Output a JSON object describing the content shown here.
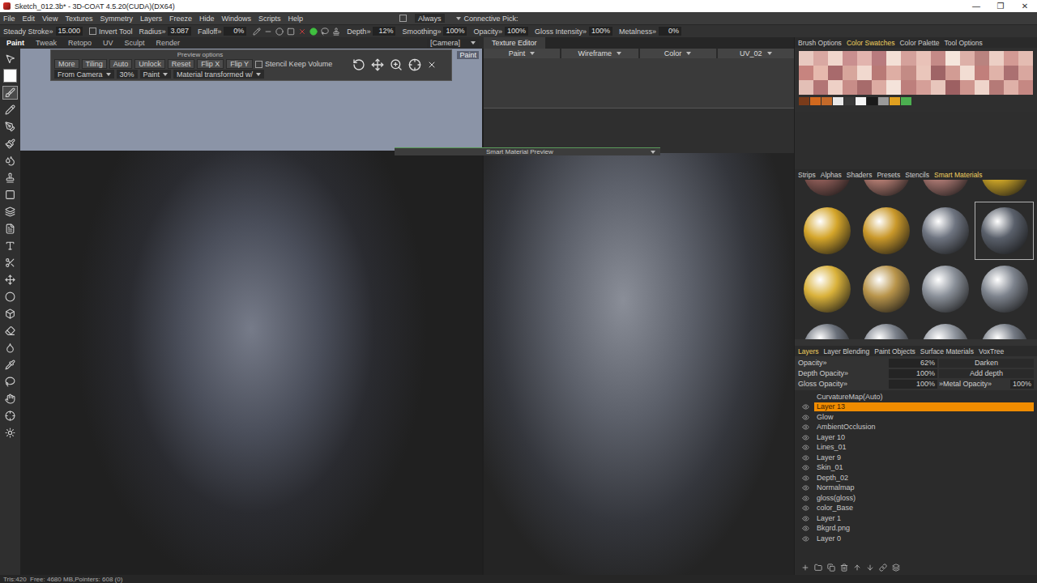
{
  "window": {
    "title": "Sketch_012.3b* - 3D-COAT 4.5.20(CUDA)(DX64)",
    "controls": [
      "—",
      "❐",
      "✕"
    ]
  },
  "menu": [
    "File",
    "Edit",
    "View",
    "Textures",
    "Symmetry",
    "Layers",
    "Freeze",
    "Hide",
    "Windows",
    "Scripts",
    "Help"
  ],
  "menu_extras": {
    "lock_box": {
      "checked": false
    },
    "always": "Always",
    "connective_pick": "Connective Pick:"
  },
  "tool_params": [
    {
      "kind": "field",
      "label": "Steady Stroke»",
      "value": "15.000"
    },
    {
      "kind": "check",
      "label": "Invert Tool",
      "checked": false
    },
    {
      "kind": "field",
      "label": "Radius»",
      "value": "3.087"
    },
    {
      "kind": "field",
      "label": "Falloff»",
      "value": "0%"
    },
    {
      "kind": "icons"
    },
    {
      "kind": "field",
      "label": "Depth»",
      "value": "12%"
    },
    {
      "kind": "field",
      "label": "Smoothing»",
      "value": "100%"
    },
    {
      "kind": "field",
      "label": "Opacity»",
      "value": "100%"
    },
    {
      "kind": "field",
      "label": "Gloss Intensity»",
      "value": "100%"
    },
    {
      "kind": "field",
      "label": "Metalness»",
      "value": "0%"
    }
  ],
  "rooms": [
    {
      "label": "Paint",
      "selected": true
    },
    {
      "label": "Tweak",
      "selected": false
    },
    {
      "label": "Retopo",
      "selected": false
    },
    {
      "label": "UV",
      "selected": false
    },
    {
      "label": "Sculpt",
      "selected": false
    },
    {
      "label": "Render",
      "selected": false
    }
  ],
  "view_mode": "[Camera]",
  "viewport_label": "Paint",
  "current_color": "#ffffff",
  "tools": [
    {
      "selected": false
    },
    {
      "selected": true
    },
    {
      "selected": false
    },
    {
      "selected": false
    },
    {
      "selected": false
    },
    {
      "selected": false
    },
    {
      "selected": false
    },
    {
      "selected": false
    },
    {
      "selected": false
    },
    {
      "selected": false
    },
    {
      "selected": false
    },
    {
      "selected": false
    },
    {
      "selected": false
    },
    {
      "selected": false
    },
    {
      "selected": false
    },
    {
      "selected": false
    },
    {
      "selected": false
    },
    {
      "selected": false
    },
    {
      "selected": false
    },
    {
      "selected": false
    },
    {
      "selected": false
    },
    {
      "selected": false
    }
  ],
  "preview_options": {
    "title": "Preview options",
    "buttons": [
      "More",
      "Tiling",
      "Auto",
      "Unlock",
      "Reset",
      "Flip X",
      "Flip Y"
    ],
    "keep_volume": {
      "label": "Stencil Keep Volume",
      "checked": false
    },
    "projection": "From Camera",
    "scale": "30%",
    "mode": "Paint",
    "transform": "Material transformed w/"
  },
  "texture_editor": {
    "title": "Texture Editor",
    "fields": [
      "Paint",
      "Wireframe",
      "Color",
      "UV_02"
    ]
  },
  "smart_material_preview": "Smart Material Preview",
  "brush_tabs": [
    {
      "label": "Brush Options",
      "selected": false
    },
    {
      "label": "Color Swatches",
      "selected": true
    },
    {
      "label": "Color Palette",
      "selected": false
    },
    {
      "label": "Tool Options",
      "selected": false
    }
  ],
  "swatches": [
    {
      "color": "#e8c9c0"
    },
    {
      "color": "#d9a8a2"
    },
    {
      "color": "#f0d6cc"
    },
    {
      "color": "#c98f8f"
    },
    {
      "color": "#e2b4ae"
    },
    {
      "color": "#b87b7e"
    },
    {
      "color": "#f3e0d6"
    },
    {
      "color": "#d4a19b"
    },
    {
      "color": "#e9c2b8"
    },
    {
      "color": "#c48a87"
    },
    {
      "color": "#f5e6dc"
    },
    {
      "color": "#ddb0a8"
    },
    {
      "color": "#b9837f"
    },
    {
      "color": "#eccfc5"
    },
    {
      "color": "#d39a94"
    },
    {
      "color": "#e4bcb2"
    },
    {
      "color": "#c7847f"
    },
    {
      "color": "#e6b9ad"
    },
    {
      "color": "#a86a6c"
    },
    {
      "color": "#d7a69c"
    },
    {
      "color": "#f1d9cf"
    },
    {
      "color": "#b97a76"
    },
    {
      "color": "#deaea4"
    },
    {
      "color": "#c38b85"
    },
    {
      "color": "#eac6bb"
    },
    {
      "color": "#9f6466"
    },
    {
      "color": "#d29c94"
    },
    {
      "color": "#f2ddd3"
    },
    {
      "color": "#c17f7b"
    },
    {
      "color": "#e0b3a9"
    },
    {
      "color": "#ab7071"
    },
    {
      "color": "#d9a79f"
    },
    {
      "color": "#e3bfb6"
    },
    {
      "color": "#b27575"
    },
    {
      "color": "#eed0c6"
    },
    {
      "color": "#c88d88"
    },
    {
      "color": "#a76b6b"
    },
    {
      "color": "#dcaba2"
    },
    {
      "color": "#f4e3da"
    },
    {
      "color": "#bd7f7c"
    },
    {
      "color": "#d59f98"
    },
    {
      "color": "#e8c6bc"
    },
    {
      "color": "#9d6062"
    },
    {
      "color": "#cf968f"
    },
    {
      "color": "#efd5cb"
    },
    {
      "color": "#b57a77"
    },
    {
      "color": "#dfb1a8"
    },
    {
      "color": "#c58883"
    }
  ],
  "swatch_strip": [
    {
      "color": "#7a3b1a"
    },
    {
      "color": "#d2691e"
    },
    {
      "color": "#c46a2a"
    },
    {
      "color": "#e8e8e8"
    },
    {
      "color": "#3a3a3a"
    },
    {
      "color": "#f5f5f5"
    },
    {
      "color": "#1a1a1a"
    },
    {
      "color": "#9a9a9a"
    },
    {
      "color": "#e0a020"
    },
    {
      "color": "#4caf50"
    }
  ],
  "library_tabs": [
    {
      "label": "Strips",
      "selected": false
    },
    {
      "label": "Alphas",
      "selected": false
    },
    {
      "label": "Shaders",
      "selected": false
    },
    {
      "label": "Presets",
      "selected": false
    },
    {
      "label": "Stencils",
      "selected": false
    },
    {
      "label": "Smart Materials",
      "selected": true
    }
  ],
  "materials": [
    {
      "color": "#8a5a55",
      "selected": false
    },
    {
      "color": "#b07a70",
      "selected": false
    },
    {
      "color": "#a87670",
      "selected": false
    },
    {
      "color": "#c9a227",
      "selected": false
    },
    {
      "color": "#d4a52a",
      "selected": false
    },
    {
      "color": "#c9982a",
      "selected": false
    },
    {
      "color": "#6e7480",
      "selected": false
    },
    {
      "color": "#5a606b",
      "selected": true
    },
    {
      "color": "#d9b13a",
      "selected": false
    },
    {
      "color": "#b8944a",
      "selected": false
    },
    {
      "color": "#8a9099",
      "selected": false
    },
    {
      "color": "#7d838d",
      "selected": false
    },
    {
      "color": "#6a707a",
      "selected": false
    },
    {
      "color": "#7a808a",
      "selected": false
    },
    {
      "color": "#8e949d",
      "selected": false
    },
    {
      "color": "#737983",
      "selected": false
    }
  ],
  "layer_tabs": [
    {
      "label": "Layers",
      "selected": true
    },
    {
      "label": "Layer Blending",
      "selected": false
    },
    {
      "label": "Paint Objects",
      "selected": false
    },
    {
      "label": "Surface Materials",
      "selected": false
    },
    {
      "label": "VoxTree",
      "selected": false
    }
  ],
  "layer_props": [
    {
      "label": "Opacity»",
      "value": "62%",
      "mode": "Darken"
    },
    {
      "label": "Depth Opacity»",
      "value": "100%",
      "mode": "Add depth"
    },
    {
      "label": "Gloss Opacity»",
      "value": "100%",
      "extra_label": "»Metal Opacity»",
      "extra_value": "100%"
    }
  ],
  "layers": [
    {
      "name": "CurvatureMap(Auto)",
      "visible": false,
      "selected": false
    },
    {
      "name": "Layer 13",
      "visible": true,
      "selected": true
    },
    {
      "name": "Glow",
      "visible": true,
      "selected": false
    },
    {
      "name": "AmbientOcclusion",
      "visible": true,
      "selected": false
    },
    {
      "name": "Layer 10",
      "visible": true,
      "selected": false
    },
    {
      "name": "Lines_01",
      "visible": true,
      "selected": false
    },
    {
      "name": "Layer 9",
      "visible": true,
      "selected": false
    },
    {
      "name": "Skin_01",
      "visible": true,
      "selected": false
    },
    {
      "name": "Depth_02",
      "visible": true,
      "selected": false
    },
    {
      "name": "Normalmap",
      "visible": true,
      "selected": false
    },
    {
      "name": "gloss(gloss)",
      "visible": true,
      "selected": false
    },
    {
      "name": "color_Base",
      "visible": true,
      "selected": false
    },
    {
      "name": "Layer 1",
      "visible": true,
      "selected": false
    },
    {
      "name": "Bkgrd.png",
      "visible": true,
      "selected": false
    },
    {
      "name": "Layer 0",
      "visible": true,
      "selected": false
    }
  ],
  "status_bar": "Tris:420  Free: 4680 MB,Pointers: 608 (0)"
}
